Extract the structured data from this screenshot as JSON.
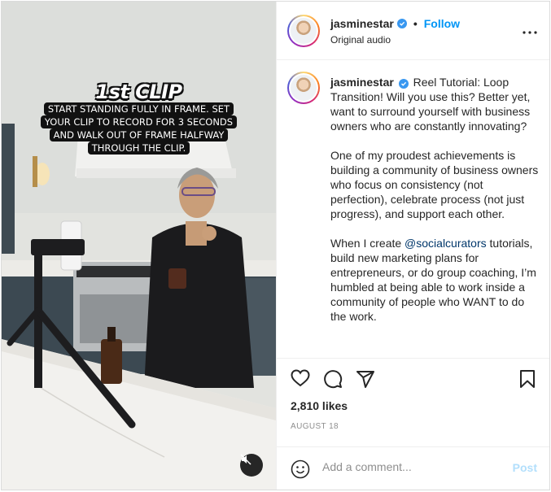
{
  "post": {
    "author": {
      "username": "jasminestar",
      "verified": true
    },
    "follow_label": "Follow",
    "separator": "•",
    "audio_label": "Original audio"
  },
  "video": {
    "clip_title": "1st CLIP",
    "clip_instructions": [
      "START STANDING FULLY IN FRAME. SET",
      "YOUR CLIP TO RECORD FOR 3 SECONDS",
      "AND WALK OUT OF FRAME HALFWAY",
      "THROUGH THE CLIP."
    ],
    "muted": true
  },
  "caption": {
    "username": "jasminestar",
    "intro": "Reel Tutorial: Loop Transition! Will you use this? Better yet, want to surround yourself with business owners who are constantly innovating?",
    "paragraph2": "One of my proudest achievements is building a community of business owners who focus on consistency (not perfection), celebrate process (not just progress), and support each other.",
    "paragraph3_before": "When I create ",
    "paragraph3_mention": "@socialcurators",
    "paragraph3_after": " tutorials, build new marketing plans for entrepreneurs, or do group coaching, I’m humbled at being able to work inside a community of people who WANT to do the work."
  },
  "engagement": {
    "likes": "2,810 likes",
    "date": "AUGUST 18"
  },
  "add_comment": {
    "placeholder": "Add a comment...",
    "post_label": "Post"
  },
  "icons": [
    "more-icon",
    "verified-icon",
    "heart-icon",
    "comment-icon",
    "share-icon",
    "bookmark-icon",
    "emoji-icon",
    "mute-icon"
  ],
  "colors": {
    "link_blue": "#0095f6",
    "mention_blue": "#00376b",
    "post_disabled": "#b2dffc",
    "muted_text": "#8e8e8e"
  }
}
